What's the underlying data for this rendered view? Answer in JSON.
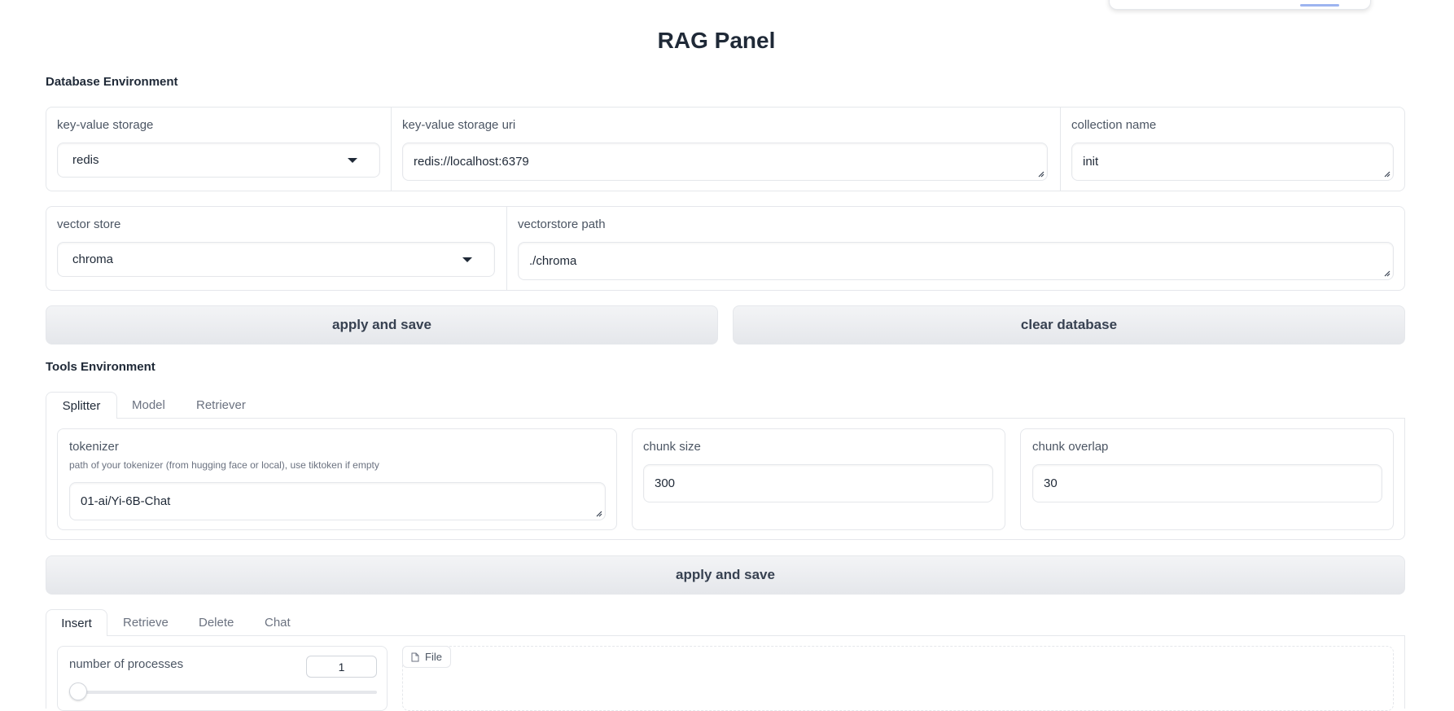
{
  "page": {
    "title": "RAG Panel"
  },
  "database_env": {
    "label": "Database Environment",
    "kv_storage": {
      "label": "key-value storage",
      "value": "redis"
    },
    "kv_uri": {
      "label": "key-value storage uri",
      "value": "redis://localhost:6379"
    },
    "collection": {
      "label": "collection name",
      "value": "init"
    },
    "vector_store": {
      "label": "vector store",
      "value": "chroma"
    },
    "vector_path": {
      "label": "vectorstore path",
      "value": "./chroma"
    },
    "apply_label": "apply and save",
    "clear_label": "clear database"
  },
  "tools_env": {
    "label": "Tools Environment",
    "tabs": [
      "Splitter",
      "Model",
      "Retriever"
    ],
    "active_tab": "Splitter",
    "tokenizer": {
      "label": "tokenizer",
      "info": "path of your tokenizer (from hugging face or local), use tiktoken if empty",
      "value": "01-ai/Yi-6B-Chat"
    },
    "chunk_size": {
      "label": "chunk size",
      "value": "300"
    },
    "chunk_overlap": {
      "label": "chunk overlap",
      "value": "30"
    },
    "apply_label": "apply and save"
  },
  "ops": {
    "tabs": [
      "Insert",
      "Retrieve",
      "Delete",
      "Chat"
    ],
    "active_tab": "Insert",
    "processes": {
      "label": "number of processes",
      "value": "1",
      "slider_fraction": 0.0
    },
    "file_label": "File"
  },
  "colors": {
    "border": "#e5e7eb",
    "text": "#1f2937",
    "muted": "#6b7280",
    "button_bg": "#e5e7eb"
  }
}
